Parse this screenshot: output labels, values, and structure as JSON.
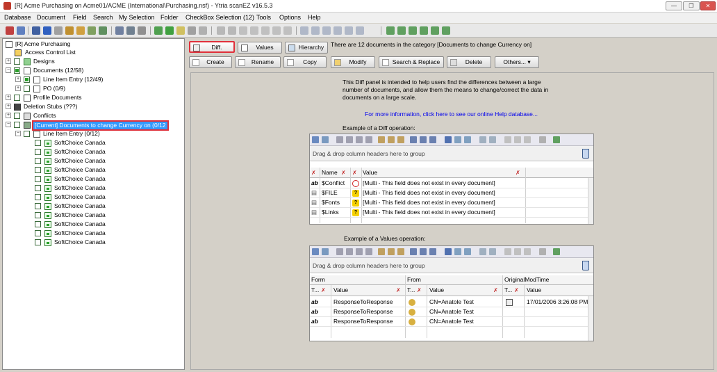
{
  "window": {
    "title": "[R] Acme Purchasing on Acme01/ACME (International\\Purchasing.nsf) - Ytria scanEZ v16.5.3",
    "minimize": "—",
    "maximize": "❐",
    "close": "✕"
  },
  "menu": [
    "Database",
    "Document",
    "Field",
    "Search",
    "My Selection",
    "Folder",
    "CheckBox Selection (12)",
    "Tools",
    "Options",
    "Help"
  ],
  "tree": {
    "root": "[R] Acme Purchasing",
    "acl": "Access Control List",
    "designs": "Designs",
    "documents": "Documents  (12/58)",
    "line_item_entry": "Line Item Entry  (12/49)",
    "po": "PO  (0/9)",
    "profile_documents": "Profile Documents",
    "deletion_stubs": "Deletion Stubs  (???)",
    "conflicts": "Conflicts",
    "current": "[Current] Documents to change Currency on  (0/12",
    "sub_line_item": "Line Item Entry  (0/12)",
    "children": [
      "SoftChoice Canada",
      "SoftChoice Canada",
      "SoftChoice Canada",
      "SoftChoice Canada",
      "SoftChoice Canada",
      "SoftChoice Canada",
      "SoftChoice Canada",
      "SoftChoice Canada",
      "SoftChoice Canada",
      "SoftChoice Canada",
      "SoftChoice Canada",
      "SoftChoice Canada"
    ]
  },
  "buttons": {
    "diff": "Diff.",
    "values": "Values",
    "hierarchy": "Hierarchy",
    "create": "Create",
    "rename": "Rename",
    "copy": "Copy",
    "modify": "Modify",
    "search_replace": "Search & Replace",
    "delete": "Delete",
    "others": "Others..."
  },
  "status_text": "There are 12 documents in the category [Documents to change Currency on]",
  "intro": "This Diff panel is intended to help users find the differences between a large number of documents, and allow them the means to change/correct the data in documents on a large scale.",
  "help_link": "For more information, click here to see our online Help database...",
  "diff_example": {
    "caption": "Example of a Diff operation:",
    "group_hint": "Drag & drop column headers here to group",
    "headers": {
      "name": "Name",
      "value": "Value"
    },
    "rows": [
      {
        "type": "ab",
        "name": "$Conflict",
        "value": "[Multi - This field does not exist in every document]"
      },
      {
        "type": "",
        "name": "$FILE",
        "value": "[Multi - This field does not exist in every document]"
      },
      {
        "type": "",
        "name": "$Fonts",
        "value": "[Multi - This field does not exist in every document]"
      },
      {
        "type": "",
        "name": "$Links",
        "value": "[Multi - This field does not exist in every document]"
      }
    ]
  },
  "values_example": {
    "caption": "Example of a Values operation:",
    "group_hint": "Drag & drop column headers here to group",
    "groups": [
      "Form",
      "From",
      "OriginalModTime"
    ],
    "subheaders": {
      "type": "T...",
      "value": "Value"
    },
    "rows": [
      {
        "type": "ab",
        "form": "ResponseToResponse",
        "from": "CN=Anatole Test",
        "modtime": "17/01/2006 3:26:08 PM"
      },
      {
        "type": "ab",
        "form": "ResponseToResponse",
        "from": "CN=Anatole Test",
        "modtime": ""
      },
      {
        "type": "ab",
        "form": "ResponseToResponse",
        "from": "CN=Anatole Test",
        "modtime": ""
      }
    ]
  }
}
